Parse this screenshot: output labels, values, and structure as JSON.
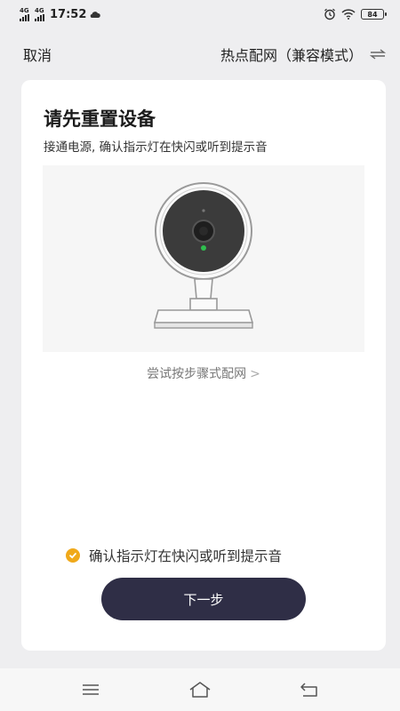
{
  "status_bar": {
    "sim1_label": "4G",
    "sim2_label": "4G",
    "time": "17:52",
    "battery": "84"
  },
  "nav": {
    "cancel_label": "取消",
    "title": "热点配网（兼容模式）",
    "switch_icon": "swap-icon"
  },
  "card": {
    "title": "请先重置设备",
    "subtitle": "接通电源, 确认指示灯在快闪或听到提示音",
    "illustration_icon": "camera-device-icon",
    "alt_mode_link": "尝试按步骤式配网",
    "confirm_text": "确认指示灯在快闪或听到提示音",
    "confirm_checked": true,
    "next_button": "下一步"
  },
  "colors": {
    "accent": "#f0a91a",
    "button": "#2f2e46",
    "background": "#eeeef0",
    "indicator_led": "#2fbf4e"
  },
  "bottom_nav": {
    "menu_icon": "menu-icon",
    "home_icon": "home-icon",
    "back_icon": "back-icon"
  }
}
